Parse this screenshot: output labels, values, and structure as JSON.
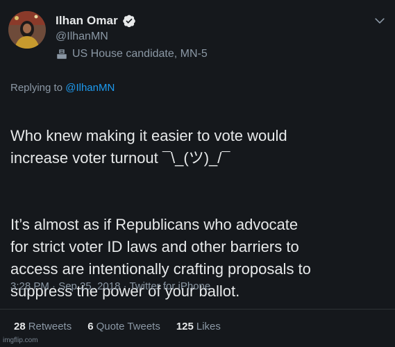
{
  "author": {
    "display_name": "Ilhan Omar",
    "handle": "@IlhanMN",
    "label": "US House candidate, MN-5",
    "verified": true,
    "avatar_icon": "profile-photo",
    "label_icon": "ballot-box-icon"
  },
  "reply": {
    "prefix": "Replying to",
    "mention": "@IlhanMN"
  },
  "tweet": {
    "paragraphs": [
      "Who knew making it easier to vote would\nincrease voter turnout ¯\\_(ツ)_/¯",
      "It’s almost as if Republicans who advocate\nfor strict voter ID laws and other barriers to\naccess are intentionally crafting proposals to\nsuppress the power of your ballot."
    ]
  },
  "meta": {
    "timestamp": "3:28 PM · Sep 25, 2018 · Twitter for iPhone"
  },
  "stats": {
    "retweets_count": "28",
    "retweets_label": "Retweets",
    "quotes_count": "6",
    "quotes_label": "Quote Tweets",
    "likes_count": "125",
    "likes_label": "Likes"
  },
  "watermark": "imgflip.com",
  "colors": {
    "background": "#15181c",
    "accent": "#1d9bf0",
    "text_primary": "#e7e9ea",
    "text_secondary": "#8b98a5",
    "divider": "#2f3336"
  }
}
